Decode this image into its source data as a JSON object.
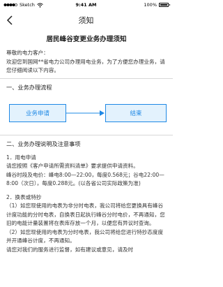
{
  "status_bar": {
    "carrier": "Sketch",
    "time": "9:41 AM",
    "battery": "100%"
  },
  "nav": {
    "title": "须知"
  },
  "doc": {
    "title": "居民峰谷变更业务办理须知",
    "greeting": "尊敬的电力客户：",
    "intro": "欢迎您到国网**省电力公司办理用电业务，为了方便您办理业务，请您仔细阅读以下内容。",
    "section1_title": "一、业务办理流程",
    "flow": {
      "step1": "业务申请",
      "step2": "结束"
    },
    "section2_title": "二、业务办理说明及注意事项",
    "item1_title": "1．用电申请",
    "item1_text": "请您按照《客户申请所需资料清单》要求提供申请资料。",
    "item1_price": "峰谷时段及电价：峰电8:00—22:00，每度0.568元；谷电22:00—8:00（次日），每度0.288元。(以各省公司实际政策为准)",
    "item2_title": "2．换表或特抄",
    "item2_p1": "（1）如您现使用的电表为非分时电表，我公司将给您更换具有峰谷计度功能的分时电表，自换表日起执行峰谷分时电价，不再通知，您旧的电能计量装置将在表库存放一个月，以便您有异议时查询。",
    "item2_p2": "（2）如您现使用的电表为分时电表，我公司将给您进行特抄态度度并开通峰谷计度，不再通知。",
    "item2_p3": "请您对我们的服务进行监督，如有建议或意见，请及时"
  }
}
